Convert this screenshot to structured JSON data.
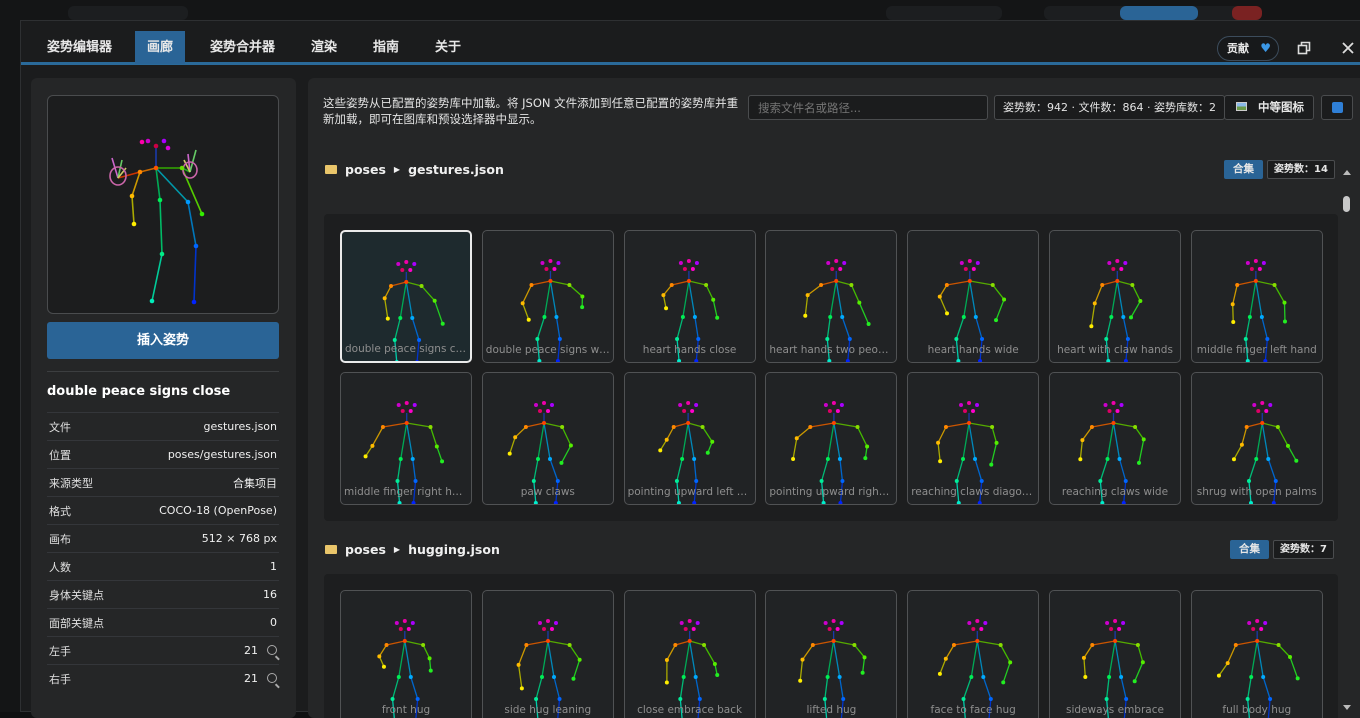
{
  "tabs": [
    "姿势编辑器",
    "画廊",
    "姿势合并器",
    "渲染",
    "指南",
    "关于"
  ],
  "active_tab": 1,
  "donate_label": "贡献",
  "icons": {
    "donate": "heart-icon",
    "restore": "restore-window-icon",
    "close": "close-icon",
    "refresh": "refresh-icon",
    "icon_size": "image-icon",
    "folder": "folder-icon"
  },
  "sidebar": {
    "insert_button": "插入姿势",
    "pose_name": "double peace signs close",
    "info": [
      {
        "key": "文件",
        "value": "gestures.json"
      },
      {
        "key": "位置",
        "value": "poses/gestures.json"
      },
      {
        "key": "来源类型",
        "value": "合集项目"
      },
      {
        "key": "格式",
        "value": "COCO-18 (OpenPose)"
      },
      {
        "key": "画布",
        "value": "512 × 768 px"
      },
      {
        "key": "人数",
        "value": "1"
      },
      {
        "key": "身体关键点",
        "value": "16"
      },
      {
        "key": "面部关键点",
        "value": "0"
      },
      {
        "key": "左手",
        "value": "21"
      },
      {
        "key": "右手",
        "value": "21"
      }
    ]
  },
  "main": {
    "description": "这些姿势从已配置的姿势库中加载。将 JSON 文件添加到任意已配置的姿势库并重新加载，即可在图库和预设选择器中显示。",
    "search_placeholder": "搜索文件名或路径...",
    "stats": "姿势数：942 · 文件数：864 · 姿势库数：2",
    "icon_size_label": "中等图标"
  },
  "groups": [
    {
      "root": "poses",
      "file": "gestures.json",
      "badge": "合集",
      "count": "姿势数：14",
      "items": [
        "double peace signs cl...",
        "double peace signs wi...",
        "heart hands close",
        "heart hands two people",
        "heart hands wide",
        "heart with claw hands",
        "middle finger left hand",
        "middle finger right hand",
        "paw claws",
        "pointing upward left h...",
        "pointing upward right ...",
        "reaching claws diagonal",
        "reaching claws wide",
        "shrug with open palms"
      ]
    },
    {
      "root": "poses",
      "file": "hugging.json",
      "badge": "合集",
      "count": "姿势数：7",
      "items": [
        "front hug",
        "side hug leaning",
        "close embrace back",
        "lifted hug",
        "face to face hug",
        "sideways embrace",
        "full body hug"
      ]
    }
  ],
  "colors": {
    "accent": "#2a6496",
    "selected_border": "#eaeaea"
  }
}
